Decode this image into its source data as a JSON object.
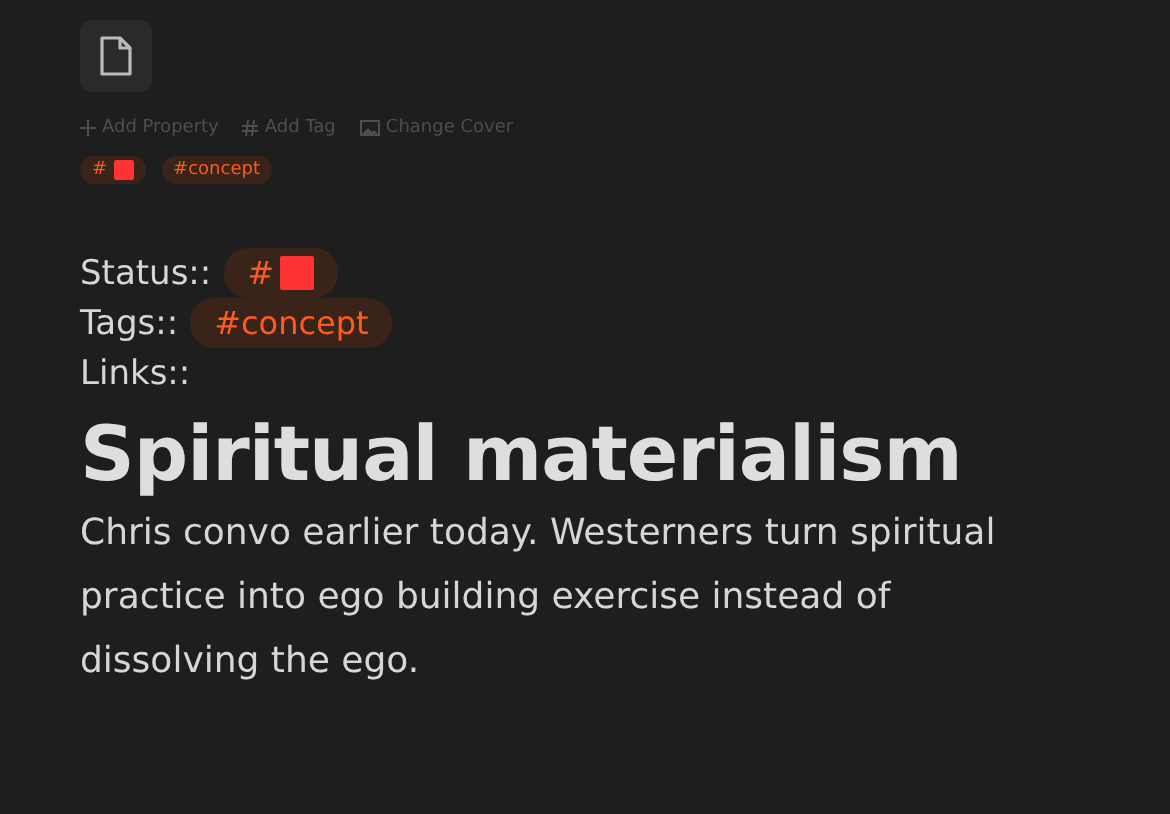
{
  "actions": [
    {
      "kind": "plus",
      "label": "Add Property"
    },
    {
      "kind": "hash",
      "label": "Add Tag"
    },
    {
      "kind": "image",
      "label": "Change Cover"
    }
  ],
  "tags": [
    {
      "kind": "swatch",
      "label": "#",
      "color": "#ff3333"
    },
    {
      "kind": "text",
      "label": "#concept"
    }
  ],
  "properties": [
    {
      "label": "Status::",
      "tag": {
        "kind": "swatch",
        "label": "#",
        "color": "#ff3333"
      }
    },
    {
      "label": "Tags::",
      "tag": {
        "kind": "text",
        "label": "#concept"
      }
    },
    {
      "label": "Links::"
    }
  ],
  "title": "Spiritual materialism",
  "body": "Chris convo earlier today. Westerners turn spiritual practice into ego building exercise instead of dissolving the ego."
}
